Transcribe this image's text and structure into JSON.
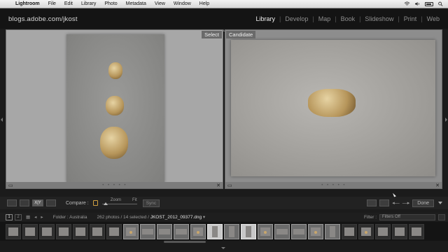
{
  "menubar": {
    "apple": "",
    "app_name": "Lightroom",
    "items": [
      "File",
      "Edit",
      "Library",
      "Photo",
      "Metadata",
      "View",
      "Window",
      "Help"
    ]
  },
  "identity_plate": "blogs.adobe.com/jkost",
  "modules": [
    {
      "label": "Library",
      "active": true
    },
    {
      "label": "Develop",
      "active": false
    },
    {
      "label": "Map",
      "active": false
    },
    {
      "label": "Book",
      "active": false
    },
    {
      "label": "Slideshow",
      "active": false
    },
    {
      "label": "Print",
      "active": false
    },
    {
      "label": "Web",
      "active": false
    }
  ],
  "compare": {
    "select_label": "Select",
    "candidate_label": "Candidate",
    "close_glyph": "✕"
  },
  "toolbar": {
    "view_xy": "X|Y",
    "compare_label": "Compare :",
    "zoom_label": "Zoom",
    "fit_label": "Fit",
    "sync_label": "Sync",
    "done_label": "Done"
  },
  "filmstrip_header": {
    "screen1": "1",
    "screen2": "2",
    "folder": "Folder : Australia",
    "count_prefix": "262 photos / 14 selected / ",
    "filename": "JKOST_2012_09377.dng",
    "filter_label": "Filter :",
    "filter_value": "Filters Off"
  },
  "colors": {
    "accent_active": "#f0f0f0",
    "background": "#1b1b1b",
    "lock_gold": "#d0a040"
  },
  "icons": {
    "apple": "apple-logo-icon",
    "wifi": "wifi-icon",
    "volume": "volume-icon",
    "battery": "battery-icon",
    "search": "spotlight-search-icon",
    "lock": "lock-icon"
  }
}
